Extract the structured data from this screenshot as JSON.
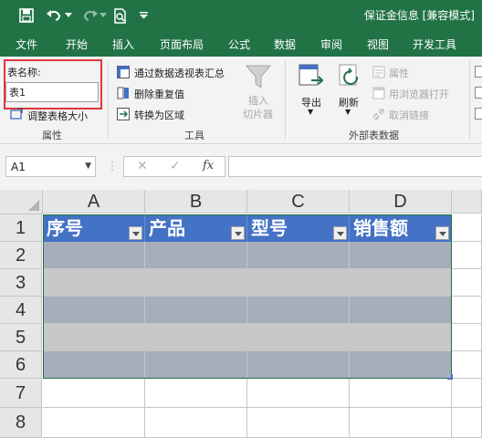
{
  "quick_access": {
    "save_icon": "save-icon",
    "undo_icon": "undo-icon",
    "redo_icon": "redo-icon",
    "print_preview_icon": "print-preview-icon",
    "customize_icon": "customize-toolbar-icon"
  },
  "window": {
    "title": "保证金信息 [兼容模式]"
  },
  "tabs": [
    "文件",
    "开始",
    "插入",
    "页面布局",
    "公式",
    "数据",
    "审阅",
    "视图",
    "开发工具"
  ],
  "ribbon": {
    "properties": {
      "name_label": "表名称:",
      "name_value": "表1",
      "resize_label": "调整表格大小",
      "group_label": "属性"
    },
    "tools": {
      "pivot_label": "通过数据透视表汇总",
      "remove_dup_label": "删除重复值",
      "convert_label": "转换为区域",
      "slicer_label": "插入\n切片器",
      "group_label": "工具"
    },
    "external": {
      "export_label": "导出",
      "refresh_label": "刷新",
      "properties_label": "属性",
      "open_browser_label": "用浏览器打开",
      "unlink_label": "取消链接",
      "group_label": "外部表数据"
    }
  },
  "formula_bar": {
    "name_box": "A1",
    "cancel_icon": "cancel-x-icon",
    "enter_icon": "checkmark-icon",
    "fx_label": "fx",
    "formula_value": ""
  },
  "sheet": {
    "columns": [
      "A",
      "B",
      "C",
      "D"
    ],
    "rows": [
      "1",
      "2",
      "3",
      "4",
      "5",
      "6",
      "7",
      "8"
    ],
    "table_headers": [
      "序号",
      "产品",
      "型号",
      "销售额"
    ],
    "colors": {
      "header_bg": "#4472c4",
      "band_dark": "#a6adbb",
      "band_light": "#c8c8c8",
      "table_border": "#217346"
    }
  }
}
